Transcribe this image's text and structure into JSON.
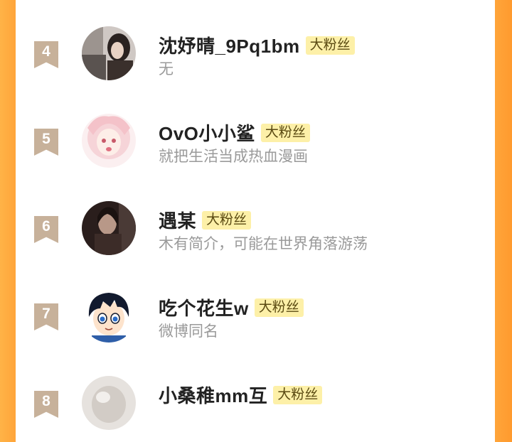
{
  "badge_label": "大粉丝",
  "rank_color": "#c7b19a",
  "badge_color": "#fdf0a8",
  "fans": [
    {
      "rank": "4",
      "name": "沈妤晴_9Pq1bm",
      "bio": "无"
    },
    {
      "rank": "5",
      "name": "OvO小小鲨",
      "bio": "就把生活当成热血漫画"
    },
    {
      "rank": "6",
      "name": "遇某",
      "bio": "木有简介，可能在世界角落游荡"
    },
    {
      "rank": "7",
      "name": "吃个花生w",
      "bio": "微博同名"
    },
    {
      "rank": "8",
      "name": "小桑稚mm互",
      "bio": ""
    }
  ]
}
